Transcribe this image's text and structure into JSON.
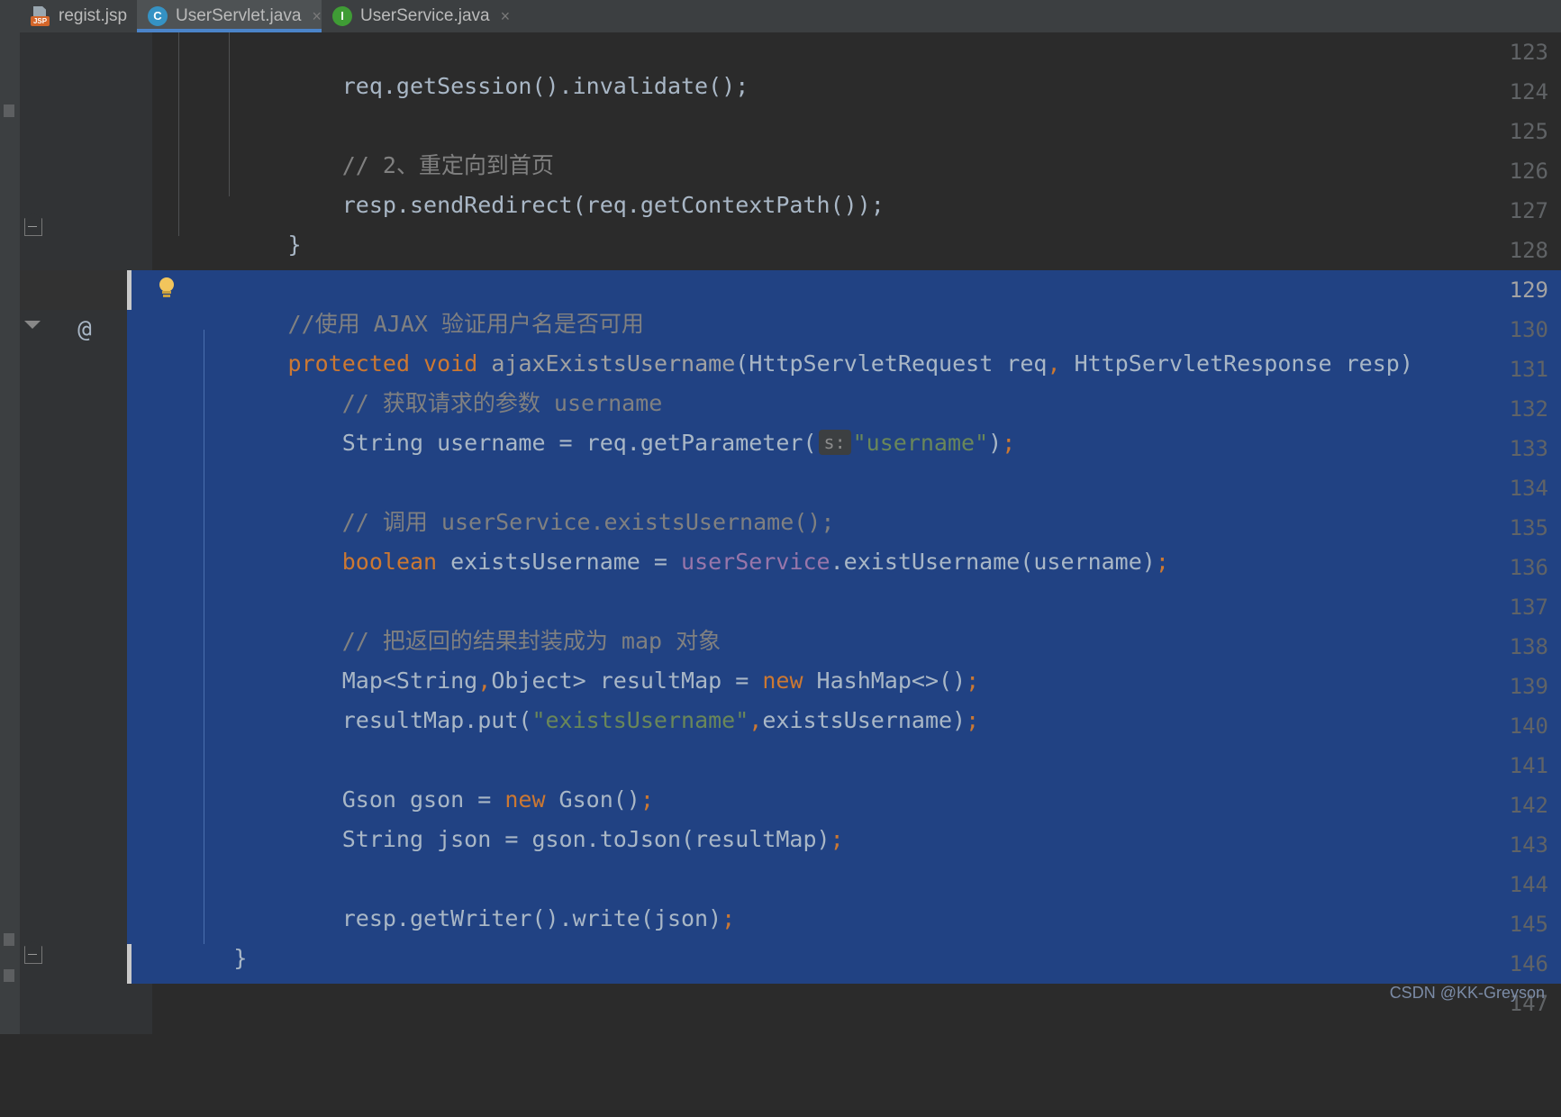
{
  "window": {
    "app": "IntelliJ IDEA",
    "theme_background": "#2b2b2b",
    "selection_color": "#214283",
    "accent_color": "#4b84c9"
  },
  "tabs": [
    {
      "label": "regist.jsp",
      "icon": "jsp-file-icon",
      "icon_text": "JSP",
      "close": "×",
      "active": false
    },
    {
      "label": "UserServlet.java",
      "icon": "java-class-icon",
      "icon_text": "C",
      "close": "×",
      "active": true
    },
    {
      "label": "UserService.java",
      "icon": "java-interface-icon",
      "icon_text": "I",
      "close": "×",
      "active": false
    }
  ],
  "editor": {
    "first_visible_line": 123,
    "caret_line": 129,
    "override_marker": "@",
    "selection_start_line": 129,
    "selection_end_line": 145,
    "parameter_hint": "s:",
    "lines": [
      {
        "num": "123",
        "text": "        req.getSession().invalidate();"
      },
      {
        "num": "124",
        "text": ""
      },
      {
        "num": "125",
        "text": "        // 2、重定向到首页"
      },
      {
        "num": "126",
        "text": "        resp.sendRedirect(req.getContextPath());"
      },
      {
        "num": "127",
        "text": "    }"
      },
      {
        "num": "128",
        "text": ""
      },
      {
        "num": "129",
        "text": "    //使用 AJAX 验证用户名是否可用"
      },
      {
        "num": "130",
        "text": "    protected void ajaxExistsUsername(HttpServletRequest req, HttpServletResponse resp)"
      },
      {
        "num": "131",
        "text": "        // 获取请求的参数 username"
      },
      {
        "num": "132",
        "text": "        String username = req.getParameter( s: \"username\");"
      },
      {
        "num": "133",
        "text": ""
      },
      {
        "num": "134",
        "text": "        // 调用 userService.existsUsername();"
      },
      {
        "num": "135",
        "text": "        boolean existsUsername = userService.existUsername(username);"
      },
      {
        "num": "136",
        "text": ""
      },
      {
        "num": "137",
        "text": "        // 把返回的结果封装成为 map 对象"
      },
      {
        "num": "138",
        "text": "        Map<String,Object> resultMap = new HashMap<>();"
      },
      {
        "num": "139",
        "text": "        resultMap.put(\"existsUsername\",existsUsername);"
      },
      {
        "num": "140",
        "text": ""
      },
      {
        "num": "141",
        "text": "        Gson gson = new Gson();"
      },
      {
        "num": "142",
        "text": "        String json = gson.toJson(resultMap);"
      },
      {
        "num": "143",
        "text": ""
      },
      {
        "num": "144",
        "text": "        resp.getWriter().write(json);"
      },
      {
        "num": "145",
        "text": "    }"
      },
      {
        "num": "146",
        "text": "}"
      },
      {
        "num": "147",
        "text": ""
      }
    ]
  },
  "watermark": {
    "text": "CSDN @KK-Greyson"
  }
}
